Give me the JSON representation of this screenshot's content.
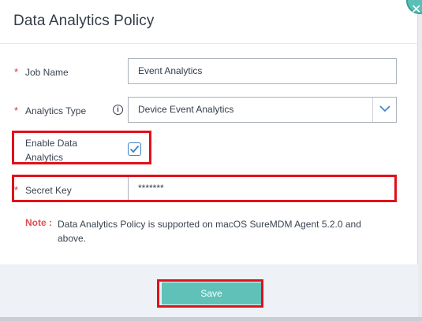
{
  "dialog": {
    "title": "Data Analytics Policy",
    "close_icon": "close-icon"
  },
  "form": {
    "required_mark": "*",
    "job_name": {
      "label": "Job Name",
      "value": "Event Analytics"
    },
    "analytics_type": {
      "label": "Analytics Type",
      "value": "Device Event Analytics",
      "info_icon": "info-icon",
      "dropdown_icon": "chevron-down-icon"
    },
    "enable_data_analytics": {
      "label_line1": "Enable Data",
      "label_line2": "Analytics",
      "checked": true
    },
    "secret_key": {
      "label": "Secret Key",
      "value": "*******"
    }
  },
  "note": {
    "label": "Note :",
    "text": "Data Analytics Policy is supported on macOS SureMDM Agent 5.2.0 and above."
  },
  "footer": {
    "save_label": "Save"
  },
  "colors": {
    "accent": "#5fc1b8",
    "required": "#d0393e",
    "highlight": "#e0111a",
    "checkbox": "#3b82c4"
  }
}
